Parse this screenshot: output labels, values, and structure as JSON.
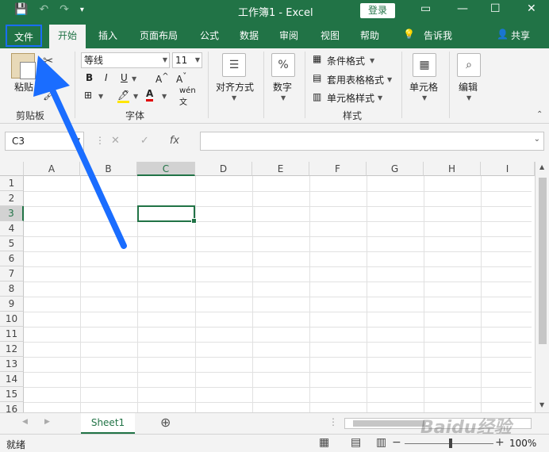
{
  "window": {
    "title": "工作簿1  -  Excel",
    "login_label": "登录"
  },
  "tabs": [
    "文件",
    "开始",
    "插入",
    "页面布局",
    "公式",
    "数据",
    "审阅",
    "视图",
    "帮助",
    "告诉我",
    "共享"
  ],
  "ribbon": {
    "paste": "粘贴",
    "clipboard_group": "剪贴板",
    "font_name": "等线",
    "font_size": "11",
    "font_group": "字体",
    "bold": "B",
    "italic": "I",
    "underline": "U",
    "align": "对齐方式",
    "number": "数字",
    "cond_format": "条件格式",
    "table_format": "套用表格格式",
    "cell_style": "单元格样式",
    "styles_group": "样式",
    "cells": "单元格",
    "editing": "编辑"
  },
  "formula": {
    "name_box": "C3",
    "fx": "fx"
  },
  "columns": [
    "A",
    "B",
    "C",
    "D",
    "E",
    "F",
    "G",
    "H",
    "I"
  ],
  "rows": [
    "1",
    "2",
    "3",
    "4",
    "5",
    "6",
    "7",
    "8",
    "9",
    "10",
    "11",
    "12",
    "13",
    "14",
    "15",
    "16"
  ],
  "selected_cell": "C3",
  "sheet": {
    "name": "Sheet1"
  },
  "status": {
    "text": "就绪",
    "zoom": "100%"
  },
  "watermark": "Baidu经验"
}
